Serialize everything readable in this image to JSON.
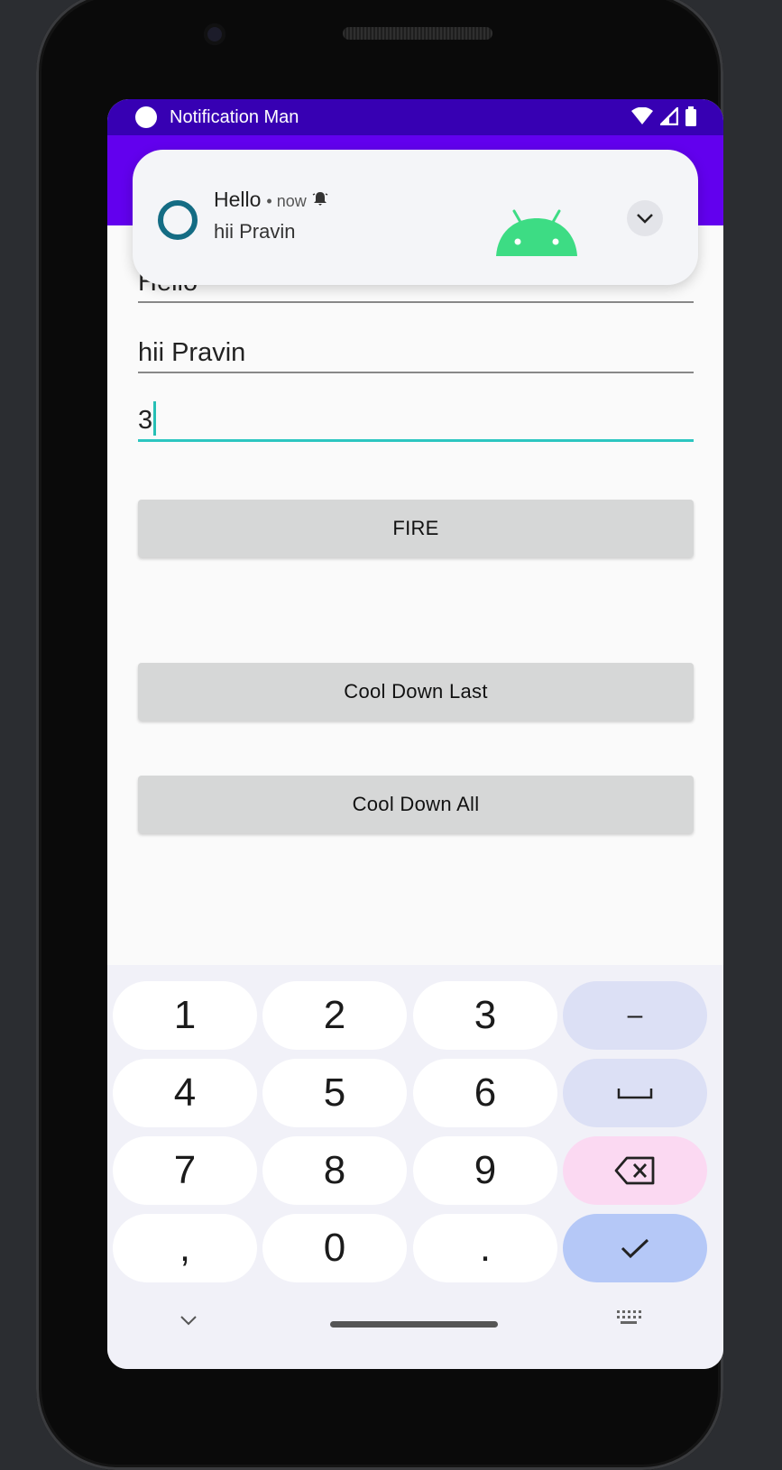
{
  "status_bar": {
    "title": "Notification Man"
  },
  "form": {
    "title_field": "Hello",
    "message_field": "hii Pravin",
    "count_field": "3"
  },
  "buttons": {
    "fire": "FIRE",
    "cool_down_last": "Cool Down Last",
    "cool_down_all": "Cool Down All"
  },
  "notification": {
    "title": "Hello",
    "meta": "• now",
    "text": "hii Pravin",
    "icon": "bell-icon"
  },
  "keyboard": {
    "rows": [
      [
        "1",
        "2",
        "3",
        "–"
      ],
      [
        "4",
        "5",
        "6",
        "space-icon"
      ],
      [
        "7",
        "8",
        "9",
        "backspace-icon"
      ],
      [
        ",",
        "0",
        ".",
        "check-icon"
      ]
    ]
  },
  "colors": {
    "status_bar": "#3700b3",
    "app_bar": "#6200ee",
    "accent": "#2cc6c0",
    "button": "#d6d7d7",
    "android_green": "#3ddc84"
  }
}
